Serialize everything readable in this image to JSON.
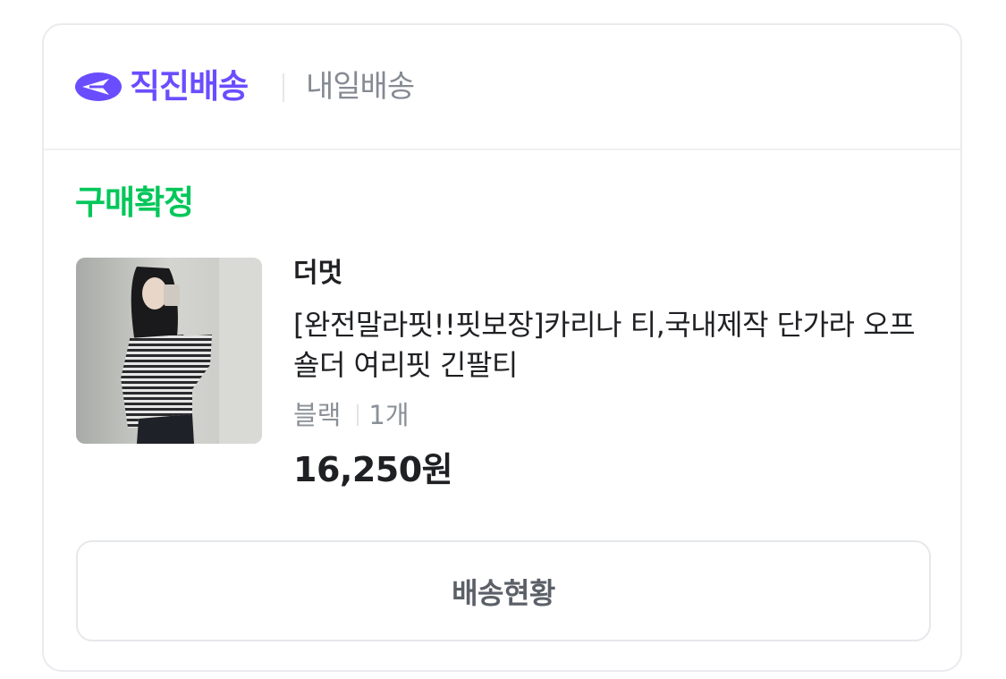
{
  "header": {
    "brand_name": "직진배송",
    "delivery_type": "내일배송",
    "brand_color": "#6a4dff"
  },
  "order": {
    "status": "구매확정",
    "status_color": "#03c75a",
    "seller": "더멋",
    "product_title": "[완전말라핏!!핏보장]카리나 티,국내제작 단가라 오프숄더 여리핏 긴팔티",
    "option_color": "블랙",
    "quantity": "1개",
    "price": "16,250원",
    "thumbnail_icon": "product-photo-striped-offshoulder-top"
  },
  "actions": {
    "tracking_label": "배송현황"
  }
}
